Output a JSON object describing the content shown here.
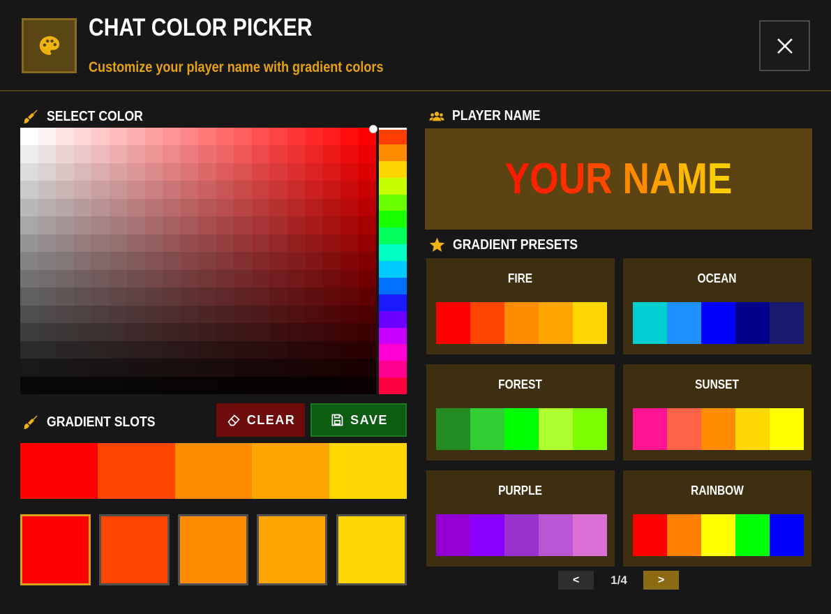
{
  "header": {
    "title": "CHAT COLOR PICKER",
    "subtitle": "Customize your player name with gradient colors",
    "logo_icon": "palette-icon",
    "close_icon": "close-icon"
  },
  "select_color": {
    "label": "SELECT COLOR",
    "icon": "paintbrush-icon",
    "hue": "#ff0000",
    "hue_strip": [
      "#ff3d00",
      "#ff8c00",
      "#ffd500",
      "#c8ff00",
      "#6aff00",
      "#18ff00",
      "#00ff5a",
      "#00ffc4",
      "#00ccff",
      "#0070ff",
      "#1a1aff",
      "#6a00ff",
      "#c800ff",
      "#ff00d4",
      "#ff0090",
      "#ff0040"
    ]
  },
  "gradient_slots": {
    "label": "GRADIENT SLOTS",
    "icon": "paintbrush-icon",
    "clear_label": "CLEAR",
    "clear_icon": "eraser-icon",
    "save_label": "SAVE",
    "save_icon": "floppy-disk-icon",
    "colors": [
      "#ff0000",
      "#ff4500",
      "#ff8c00",
      "#ffa500",
      "#ffd700"
    ],
    "active_slot": 0
  },
  "player_name": {
    "label": "PLAYER NAME",
    "icon": "users-icon",
    "text": "YOUR NAME",
    "letter_colors": [
      "#ff1a00",
      "#ff2200",
      "#ff3000",
      "#ff4800",
      "#ff6c00",
      "#ff8a00",
      "#ffa000",
      "#ffb800",
      "#ffcc00"
    ]
  },
  "presets": {
    "label": "GRADIENT PRESETS",
    "icon": "star-icon",
    "items": [
      {
        "name": "FIRE",
        "colors": [
          "#ff0000",
          "#ff4500",
          "#ff8c00",
          "#ffa500",
          "#ffd700"
        ]
      },
      {
        "name": "OCEAN",
        "colors": [
          "#00ced1",
          "#1e90ff",
          "#0000ff",
          "#00008b",
          "#191970"
        ]
      },
      {
        "name": "FOREST",
        "colors": [
          "#228b22",
          "#32cd32",
          "#00ff00",
          "#adff2f",
          "#7cfc00"
        ]
      },
      {
        "name": "SUNSET",
        "colors": [
          "#ff1493",
          "#ff6347",
          "#ff8c00",
          "#ffd700",
          "#ffff00"
        ]
      },
      {
        "name": "PURPLE",
        "colors": [
          "#9400d3",
          "#8a00ff",
          "#9932cc",
          "#ba55d3",
          "#da70d6"
        ]
      },
      {
        "name": "RAINBOW",
        "colors": [
          "#ff0000",
          "#ff7f00",
          "#ffff00",
          "#00ff00",
          "#0000ff"
        ]
      }
    ],
    "pager": {
      "prev": "<",
      "next": ">",
      "text": "1/4"
    }
  }
}
